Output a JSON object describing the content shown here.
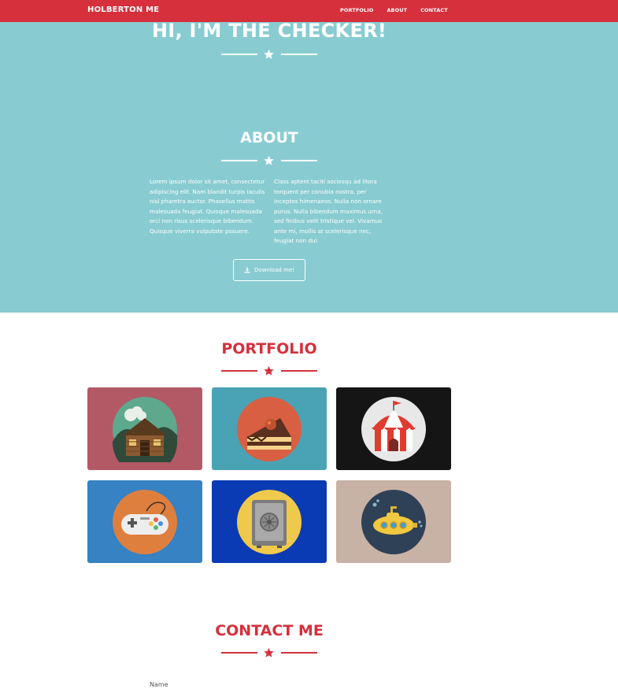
{
  "colors": {
    "brand_red": "#d6303c",
    "teal": "#88ccd1",
    "white": "#ffffff"
  },
  "navbar": {
    "brand": "HOLBERTON ME",
    "links": [
      {
        "label": "PORTFOLIO"
      },
      {
        "label": "ABOUT"
      },
      {
        "label": "CONTACT"
      }
    ]
  },
  "hero": {
    "title": "HI, I'M THE CHECKER!"
  },
  "about": {
    "title": "ABOUT",
    "left_text": "Lorem ipsum dolor sit amet, consectetur adipiscing elit. Nam blandit turpis iaculis nisl pharetra auctor. Phasellus mattis malesuada feugiat. Quisque malesuada orci non risus scelerisque bibendum. Quisque viverra vulputate posuere.",
    "right_text": "Class aptent taciti sociosqu ad litora torquent per conubia nostra, per inceptos himenaeos. Nulla non ornare purus. Nulla bibendum maximus urna, sed finibus velit tristique vel. Vivamus ante mi, mollis at scelerisque nec, feugiat non dui.",
    "download_label": "Download me!",
    "download_icon": "download-icon"
  },
  "portfolio": {
    "title": "PORTFOLIO",
    "items": [
      {
        "icon": "cabin-icon",
        "bg": "#b35966"
      },
      {
        "icon": "cake-icon",
        "bg": "#4aa3b5"
      },
      {
        "icon": "circus-tent-icon",
        "bg": "#151515"
      },
      {
        "icon": "game-controller-icon",
        "bg": "#3682c2"
      },
      {
        "icon": "safe-icon",
        "bg": "#0b3bb4"
      },
      {
        "icon": "submarine-icon",
        "bg": "#c8b2a5"
      }
    ]
  },
  "contact": {
    "title": "CONTACT ME",
    "name_label": "Name"
  }
}
